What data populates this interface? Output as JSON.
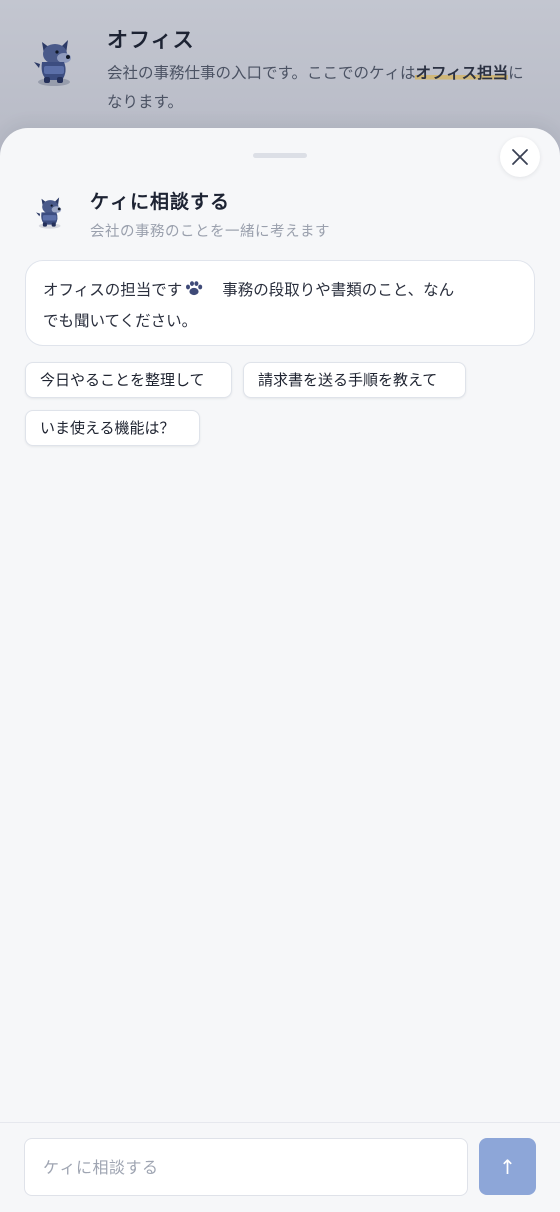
{
  "background_page": {
    "title": "オフィス",
    "description_before": "会社の事務仕事の入口です。ここでのケィは",
    "description_highlight": "オフィス担当",
    "description_after": "になります。"
  },
  "sheet": {
    "title": "ケィに相談する",
    "subtitle": "会社の事務のことを一緒に考えます",
    "close_icon": "close-icon",
    "message": {
      "line1_before": "オフィスの担当です",
      "paw_icon": "paw-icon",
      "line1_after": "事務の段取りや書類のこと、なん",
      "line2": "でも聞いてください。"
    },
    "suggestions": [
      "今日やることを整理して",
      "請求書を送る手順を教えて",
      "いま使える機能は？"
    ]
  },
  "composer": {
    "placeholder": "ケィに相談する",
    "send_label": "↑"
  },
  "colors": {
    "accent": "#8da6d8",
    "highlight": "#d6b45c",
    "sheet_bg": "#f6f7f9"
  }
}
